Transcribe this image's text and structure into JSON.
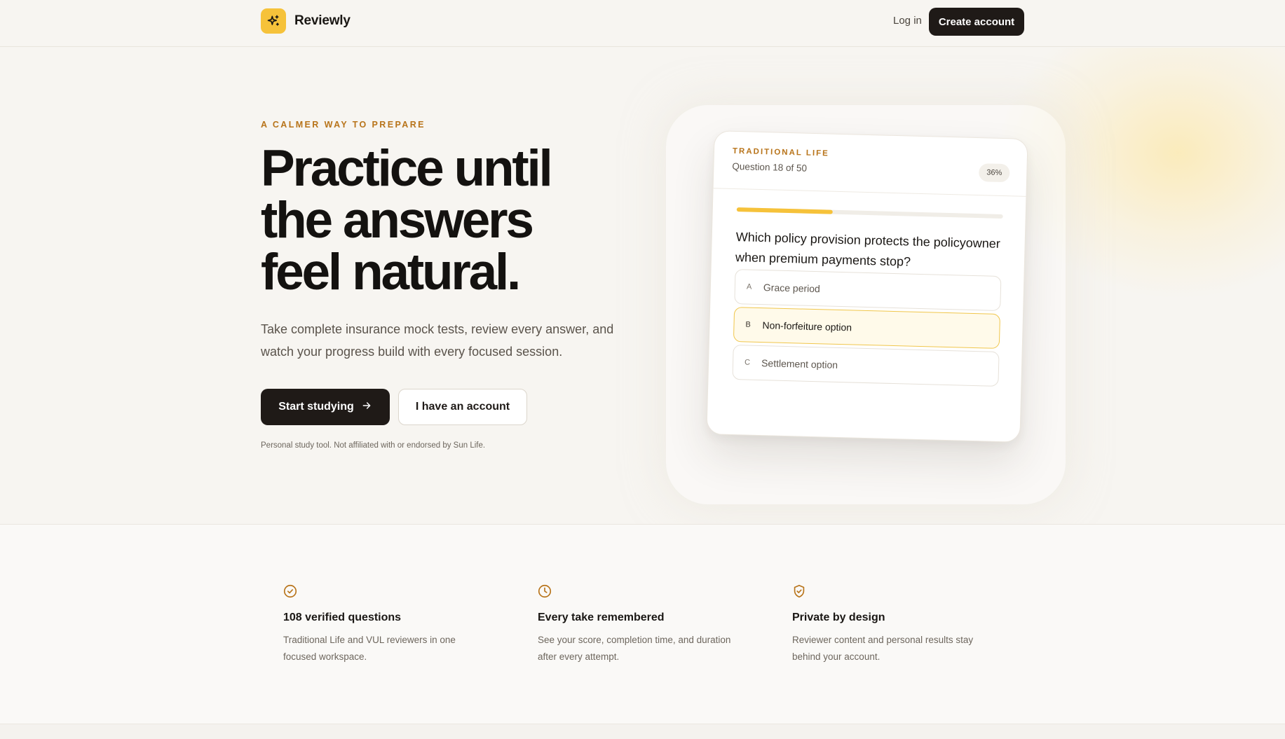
{
  "brand": {
    "name": "Reviewly",
    "logo_icon": "sparkle-icon",
    "accent": "#f6c23a"
  },
  "nav": {
    "login_label": "Log in",
    "create_account_label": "Create account"
  },
  "hero": {
    "eyebrow": "A CALMER WAY TO PREPARE",
    "headline_lines": [
      "Practice until",
      "the answers",
      "feel natural."
    ],
    "lede": "Take complete insurance mock tests, review every answer, and watch your progress build with every focused session.",
    "primary_cta": "Start studying",
    "secondary_cta": "I have an account",
    "disclaimer": "Personal study tool. Not affiliated with or endorsed by Sun Life."
  },
  "quiz_card": {
    "category": "TRADITIONAL LIFE",
    "question_count": "Question 18 of 50",
    "percent_label": "36%",
    "progress_fraction": 0.36,
    "question": "Which policy provision protects the policyowner when premium payments stop?",
    "options": [
      {
        "letter": "A",
        "text": "Grace period",
        "selected": false
      },
      {
        "letter": "B",
        "text": "Non-forfeiture option",
        "selected": true
      },
      {
        "letter": "C",
        "text": "Settlement option",
        "selected": false
      }
    ]
  },
  "features": [
    {
      "icon": "check-circle-icon",
      "title": "108 verified questions",
      "description": "Traditional Life and VUL reviewers in one focused workspace."
    },
    {
      "icon": "clock-icon",
      "title": "Every take remembered",
      "description": "See your score, completion time, and duration after every attempt."
    },
    {
      "icon": "shield-check-icon",
      "title": "Private by design",
      "description": "Reviewer content and personal results stay behind your account."
    }
  ]
}
